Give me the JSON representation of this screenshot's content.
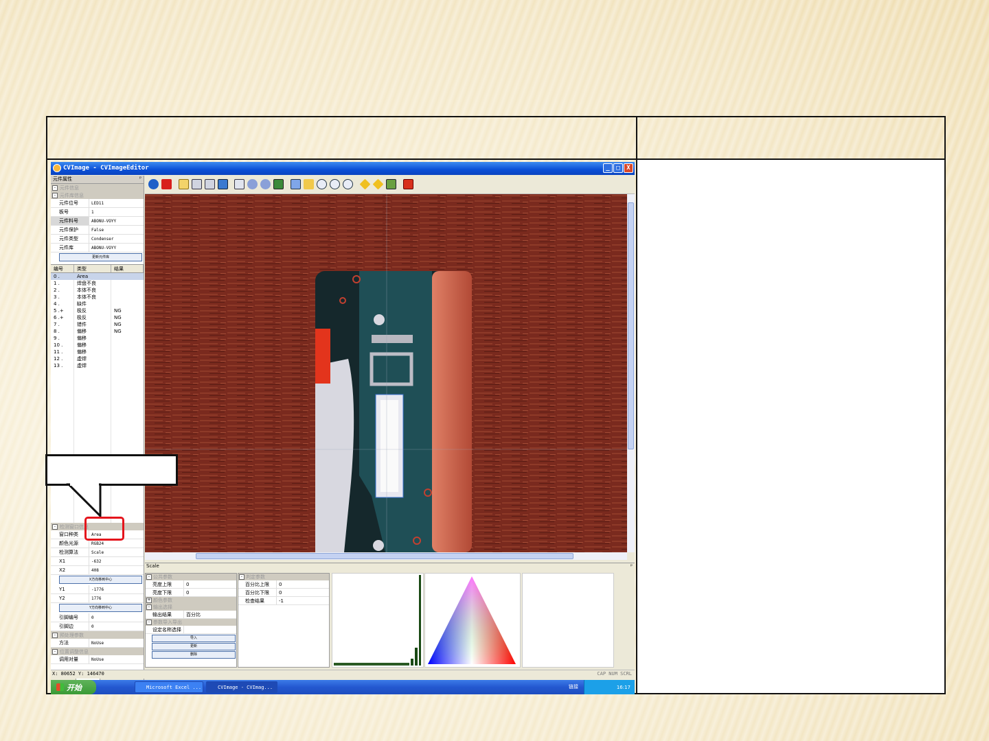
{
  "window": {
    "title": "CVImage - CVImageEditor",
    "min": "_",
    "max": "□",
    "close": "X"
  },
  "left_pane": {
    "header": "元件属性",
    "pin": "ᵖ",
    "section_component_info": "元件信息",
    "section_component_lib": "元件库信息",
    "props": [
      {
        "key": "元件位号",
        "value": "LED11"
      },
      {
        "key": "板号",
        "value": "1"
      },
      {
        "key": "元件料号",
        "value": "ABONU-VOYY"
      },
      {
        "key": "元件保护",
        "value": "False"
      },
      {
        "key": "元件类型",
        "value": "Condenser"
      },
      {
        "key": "元件库",
        "value": "ABONU-VOYY"
      }
    ],
    "update_lib_button": "更新元件库",
    "list_headers": [
      "编号",
      "类型",
      "结果"
    ],
    "list_rows": [
      {
        "num": "0 .",
        "type": "Area",
        "result": ""
      },
      {
        "num": "1 .",
        "type": "焊盘不良",
        "result": ""
      },
      {
        "num": "2 .",
        "type": "本体不良",
        "result": ""
      },
      {
        "num": "3 .",
        "type": "本体不良",
        "result": ""
      },
      {
        "num": "4 .",
        "type": "缺件",
        "result": ""
      },
      {
        "num": "5 .+",
        "type": "极反",
        "result": "NG"
      },
      {
        "num": "6 .+",
        "type": "极反",
        "result": "NG"
      },
      {
        "num": "7 .",
        "type": "错件",
        "result": "NG"
      },
      {
        "num": "8 .",
        "type": "偏移",
        "result": "NG"
      },
      {
        "num": "9 .",
        "type": "偏移",
        "result": ""
      },
      {
        "num": "10 .",
        "type": "偏移",
        "result": ""
      },
      {
        "num": "11 .",
        "type": "偏移",
        "result": ""
      },
      {
        "num": "12 .",
        "type": "虚焊",
        "result": ""
      },
      {
        "num": "13 .",
        "type": "虚焊",
        "result": ""
      }
    ],
    "section_window_info": "检测窗口信息",
    "window_props": [
      {
        "key": "窗口种类",
        "value": "Area"
      },
      {
        "key": "颜色光源",
        "value": "RGB24"
      },
      {
        "key": "检测算法",
        "value": "Scale"
      },
      {
        "key": "X1",
        "value": "-632"
      },
      {
        "key": "X2",
        "value": "408"
      }
    ],
    "x_center_button": "X方向移到中心",
    "window_props2": [
      {
        "key": "Y1",
        "value": "-1776"
      },
      {
        "key": "Y2",
        "value": "1776"
      }
    ],
    "y_center_button": "Y方向移到中心",
    "window_props3": [
      {
        "key": "引脚编号",
        "value": "0"
      },
      {
        "key": "引脚边",
        "value": "0"
      }
    ],
    "section_preprocess": "预处理参数",
    "preprocess_props": [
      {
        "key": "方法",
        "value": "NoUse"
      }
    ],
    "section_position": "位置调整信息",
    "position_props": [
      {
        "key": "调用对量",
        "value": "NoUse"
      }
    ],
    "tabs": [
      "基板信息",
      "元件属性"
    ]
  },
  "bottom_pane": {
    "header": "Scale",
    "pin": "ᵖ",
    "s1": "公共参数",
    "s1_rows": [
      {
        "key": "亮度上限",
        "value": "0"
      },
      {
        "key": "亮度下限",
        "value": "0"
      }
    ],
    "s2": "颜色参数",
    "s3": "输出选择",
    "s3_rows": [
      {
        "key": "输出结果",
        "value": "百分比"
      }
    ],
    "s4": "参数导入导出",
    "s4_rows": [
      {
        "key": "设定名称选择",
        "value": ""
      }
    ],
    "import_button": "导入",
    "save_button": "更新",
    "delete_button": "删除",
    "r1": "判定参数",
    "r1_rows": [
      {
        "key": "百分比上限",
        "value": "0"
      },
      {
        "key": "百分比下限",
        "value": "0"
      },
      {
        "key": "检查结果",
        "value": "-1"
      }
    ]
  },
  "status": {
    "coords": "X: 80652 Y: 146470",
    "indicators": "CAP  NUM  SCRL"
  },
  "taskbar": {
    "start": "开始",
    "items": [
      "Microsoft Excel ...",
      "CVImage - CVImag..."
    ],
    "link": "链接",
    "clock": "16:17"
  },
  "colors": {
    "accent": "#0a4fd6",
    "callout_red": "#e4141c",
    "pcb_red": "#7a2a1e",
    "pcb_teal": "#1f4f56"
  }
}
